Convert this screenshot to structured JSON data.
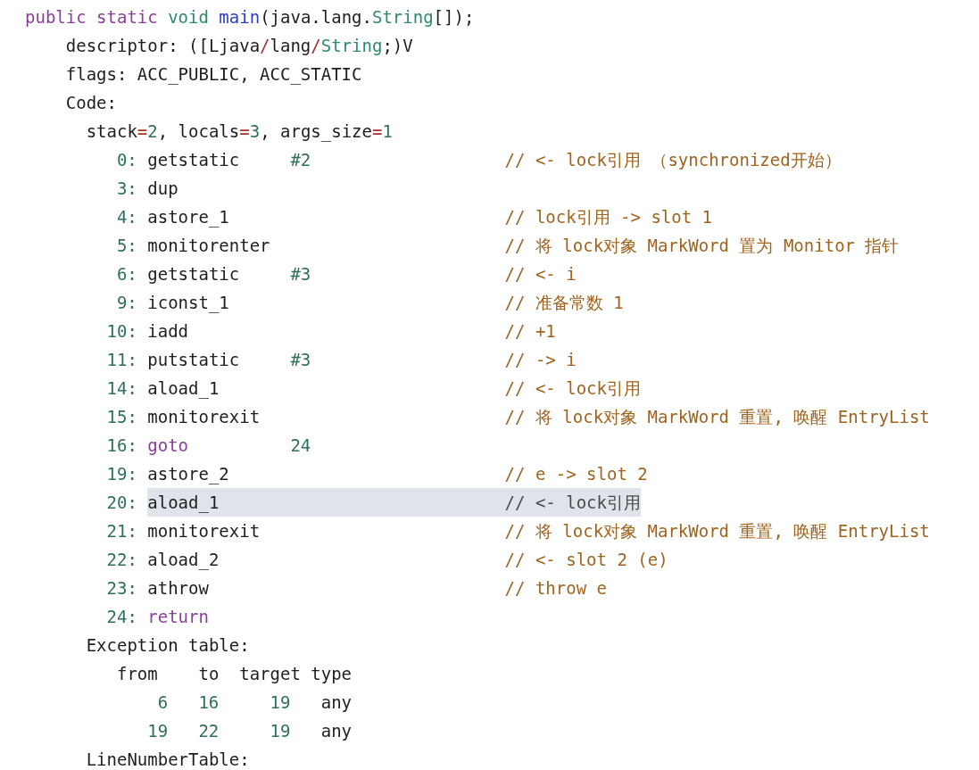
{
  "method": {
    "signature": [
      {
        "text": "public static ",
        "kind": "keyword"
      },
      {
        "text": "void ",
        "kind": "type"
      },
      {
        "text": "main",
        "kind": "func"
      },
      {
        "text": "(java.lang.",
        "kind": "plain"
      },
      {
        "text": "String",
        "kind": "type"
      },
      {
        "text": "[]);",
        "kind": "plain"
      }
    ],
    "descriptor": [
      {
        "text": "descriptor: ([Ljava",
        "kind": "plain"
      },
      {
        "text": "/",
        "kind": "operator"
      },
      {
        "text": "lang",
        "kind": "plain"
      },
      {
        "text": "/",
        "kind": "operator"
      },
      {
        "text": "String",
        "kind": "type"
      },
      {
        "text": ";)V",
        "kind": "plain"
      }
    ],
    "flags": "flags: ACC_PUBLIC, ACC_STATIC",
    "code": {
      "label": "Code:",
      "stack": [
        {
          "text": "stack",
          "kind": "plain"
        },
        {
          "text": "=",
          "kind": "operator"
        },
        {
          "text": "2",
          "kind": "number"
        },
        {
          "text": ", locals",
          "kind": "plain"
        },
        {
          "text": "=",
          "kind": "operator"
        },
        {
          "text": "3",
          "kind": "number"
        },
        {
          "text": ", args_size",
          "kind": "plain"
        },
        {
          "text": "=",
          "kind": "operator"
        },
        {
          "text": "1",
          "kind": "number"
        }
      ],
      "instructions": [
        {
          "offset": "0:",
          "opcode": "getstatic",
          "kind": "instruction",
          "operand": "#2",
          "comment": "// <- lock引用 （synchronized开始）",
          "highlighted": false
        },
        {
          "offset": "3:",
          "opcode": "dup",
          "kind": "instruction",
          "highlighted": false
        },
        {
          "offset": "4:",
          "opcode": "astore_1",
          "kind": "instruction",
          "comment": "// lock引用 -> slot 1",
          "highlighted": false
        },
        {
          "offset": "5:",
          "opcode": "monitorenter",
          "kind": "instruction",
          "comment": "// 将 lock对象 MarkWord 置为 Monitor 指针",
          "highlighted": false
        },
        {
          "offset": "6:",
          "opcode": "getstatic",
          "kind": "instruction",
          "operand": "#3",
          "comment": "// <- i",
          "highlighted": false
        },
        {
          "offset": "9:",
          "opcode": "iconst_1",
          "kind": "instruction",
          "comment": "// 准备常数 1",
          "highlighted": false
        },
        {
          "offset": "10:",
          "opcode": "iadd",
          "kind": "instruction",
          "comment": "// +1",
          "highlighted": false
        },
        {
          "offset": "11:",
          "opcode": "putstatic",
          "kind": "instruction",
          "operand": "#3",
          "comment": "// -> i",
          "highlighted": false
        },
        {
          "offset": "14:",
          "opcode": "aload_1",
          "kind": "instruction",
          "comment": "// <- lock引用",
          "highlighted": false
        },
        {
          "offset": "15:",
          "opcode": "monitorexit",
          "kind": "instruction",
          "comment": "// 将 lock对象 MarkWord 重置, 唤醒 EntryList",
          "highlighted": false
        },
        {
          "offset": "16:",
          "opcode": "goto",
          "kind": "keyword",
          "operand": "24",
          "highlighted": false
        },
        {
          "offset": "19:",
          "opcode": "astore_2",
          "kind": "instruction",
          "comment": "// e -> slot 2",
          "highlighted": false
        },
        {
          "offset": "20:",
          "opcode": "aload_1",
          "kind": "instruction",
          "comment": "// <- lock引用",
          "highlighted": true
        },
        {
          "offset": "21:",
          "opcode": "monitorexit",
          "kind": "instruction",
          "comment": "// 将 lock对象 MarkWord 重置, 唤醒 EntryList",
          "highlighted": false
        },
        {
          "offset": "22:",
          "opcode": "aload_2",
          "kind": "instruction",
          "comment": "// <- slot 2 (e)",
          "highlighted": false
        },
        {
          "offset": "23:",
          "opcode": "athrow",
          "kind": "instruction",
          "comment": "// throw e",
          "highlighted": false
        },
        {
          "offset": "24:",
          "opcode": "return",
          "kind": "keyword",
          "highlighted": false
        }
      ],
      "exception_table": {
        "title": "Exception table:",
        "columns": [
          "from",
          "to",
          "target",
          "type"
        ],
        "rows": [
          [
            "6",
            "16",
            "19",
            "any"
          ],
          [
            "19",
            "22",
            "19",
            "any"
          ]
        ]
      },
      "line_number_table": {
        "title": "LineNumberTable:"
      }
    }
  }
}
